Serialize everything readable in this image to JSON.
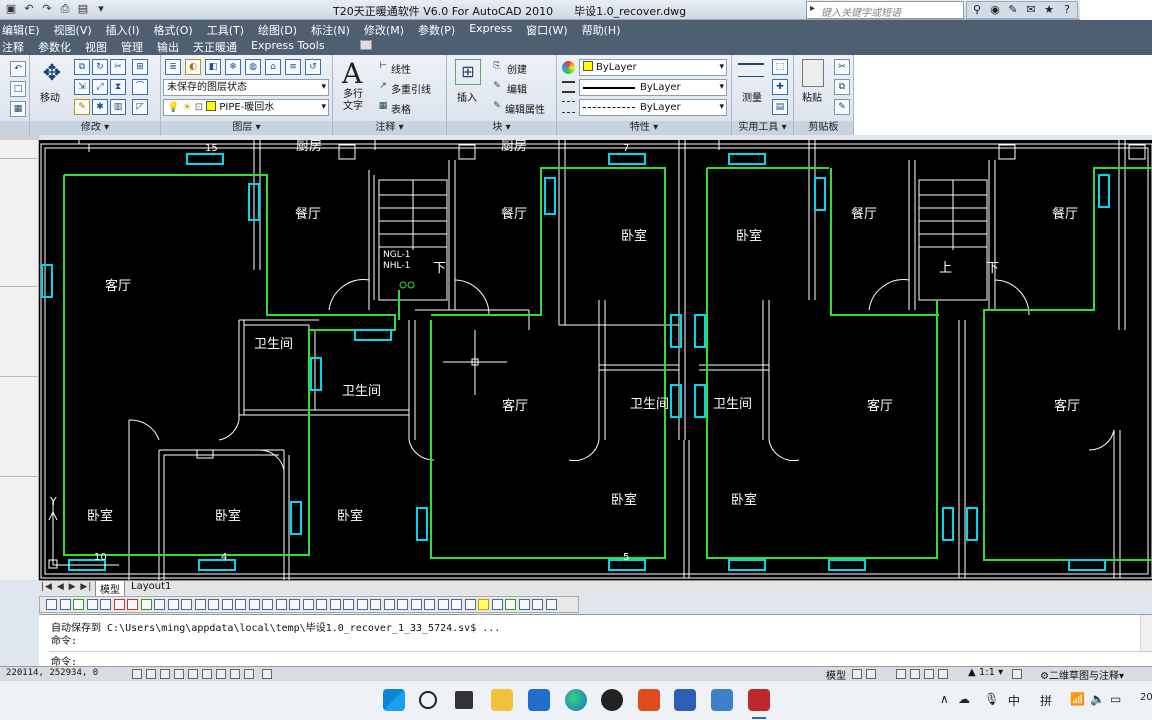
{
  "window": {
    "title": "T20天正暖通软件 V6.0 For AutoCAD 2010      毕设1.0_recover.dwg",
    "search_placeholder": "键入关键字或短语"
  },
  "menubar": [
    "编辑(E)",
    "视图(V)",
    "插入(I)",
    "格式(O)",
    "工具(T)",
    "绘图(D)",
    "标注(N)",
    "修改(M)",
    "参数(P)",
    "Express",
    "窗口(W)",
    "帮助(H)"
  ],
  "ribbon_tabs": [
    "注释",
    "参数化",
    "视图",
    "管理",
    "输出",
    "天正暖通",
    "Express Tools"
  ],
  "ribbon": {
    "modify": {
      "label": "修改",
      "move": "移动"
    },
    "layers": {
      "label": "图层",
      "state": "未保存的图层状态",
      "current": "PIPE-暖回水"
    },
    "annotation": {
      "label": "注释",
      "mtext": "多行文字",
      "linear": "线性",
      "mleader": "多重引线",
      "table": "表格"
    },
    "block": {
      "label": "块",
      "insert": "插入",
      "create": "创建",
      "edit": "编辑",
      "edit_attr": "编辑属性"
    },
    "properties": {
      "label": "特性",
      "color": "ByLayer",
      "linetype": "ByLayer",
      "lineweight": "ByLayer"
    },
    "utilities": {
      "label": "实用工具",
      "measure": "测量"
    },
    "clipboard": {
      "label": "剪贴板",
      "paste": "粘贴"
    }
  },
  "drawing": {
    "rooms": [
      "厨房",
      "厨房",
      "餐厅",
      "餐厅",
      "餐厅",
      "餐厅",
      "客厅",
      "客厅",
      "客厅",
      "客厅",
      "卧室",
      "卧室",
      "卧室",
      "卧室",
      "卧室",
      "卧室",
      "卧室",
      "卫生间",
      "卫生间",
      "卫生间",
      "卫生间",
      "下",
      "上",
      "下"
    ],
    "numbers": [
      "15",
      "7",
      "10",
      "4",
      "5"
    ],
    "pipe_labels": [
      "NGL-1",
      "NHL-1"
    ],
    "axis_y": "Y"
  },
  "layout_tabs": {
    "model": "模型",
    "layout": "Layout1"
  },
  "command": {
    "line1": "自动保存到 C:\\Users\\ming\\appdata\\local\\temp\\毕设1.0_recover_1_33_5724.sv$ ...",
    "line2": "命令:",
    "prompt": "命令:"
  },
  "status": {
    "coords": "220114, 252934, 0",
    "model": "模型",
    "scale": "1:1",
    "workspace": "二维草图与注释"
  },
  "tray": {
    "ime1": "中",
    "ime2": "拼",
    "clock": "20"
  },
  "colors": {
    "pipe": "#33dd33",
    "radiator": "#00d8f0",
    "wall": "#ffffff",
    "menubar": "#4f5f72"
  }
}
